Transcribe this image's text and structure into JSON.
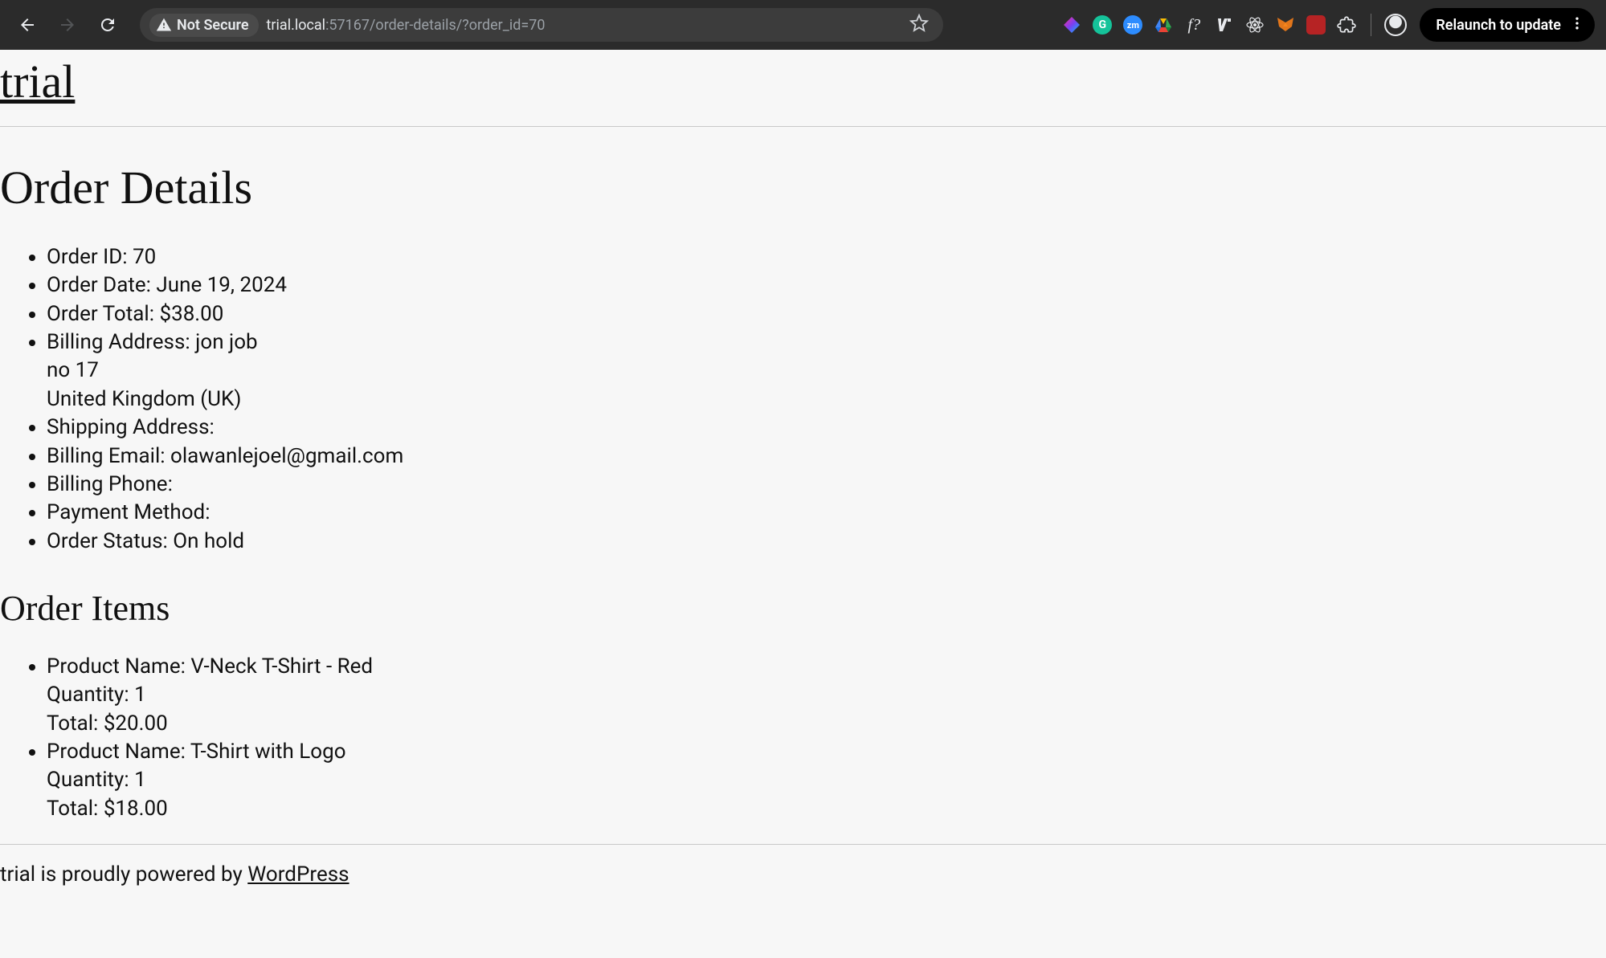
{
  "browser": {
    "not_secure_label": "Not Secure",
    "url_host": "trial.local",
    "url_rest": ":57167/order-details/?order_id=70",
    "relaunch_label": "Relaunch to update",
    "extensions": [
      {
        "name": "rainbow-diamond-icon",
        "bg": "transparent",
        "shape": "diamond"
      },
      {
        "name": "grammarly-icon",
        "bg": "#15c39a",
        "shape": "circle",
        "letter": "G"
      },
      {
        "name": "zoom-icon",
        "bg": "#2d8cff",
        "shape": "square",
        "text": "zm"
      },
      {
        "name": "drive-icon",
        "bg": "transparent",
        "shape": "triangle"
      },
      {
        "name": "fquestion-icon",
        "bg": "transparent",
        "shape": "text",
        "text": "f?"
      },
      {
        "name": "upi-icon",
        "bg": "transparent",
        "shape": "glyph"
      },
      {
        "name": "atom-icon",
        "bg": "transparent",
        "shape": "atom"
      },
      {
        "name": "metamask-icon",
        "bg": "transparent",
        "shape": "fox"
      },
      {
        "name": "red-square-icon",
        "bg": "#b62324",
        "shape": "square"
      },
      {
        "name": "extensions-puzzle-icon",
        "bg": "transparent",
        "shape": "puzzle"
      }
    ]
  },
  "site": {
    "title": "trial"
  },
  "order": {
    "heading": "Order Details",
    "labels": {
      "id": "Order ID:",
      "date": "Order Date:",
      "total": "Order Total:",
      "billing_address": "Billing Address:",
      "shipping_address": "Shipping Address:",
      "billing_email": "Billing Email:",
      "billing_phone": "Billing Phone:",
      "payment_method": "Payment Method:",
      "status": "Order Status:"
    },
    "id": "70",
    "date": "June 19, 2024",
    "total": "$38.00",
    "billing_address_line1": "jon job",
    "billing_address_line2": "no 17",
    "billing_address_line3": "United Kingdom (UK)",
    "shipping_address": "",
    "billing_email": "olawanlejoel@gmail.com",
    "billing_phone": "",
    "payment_method": "",
    "status": "On hold"
  },
  "items_heading": "Order Items",
  "item_labels": {
    "name": "Product Name:",
    "qty": "Quantity:",
    "total": "Total:"
  },
  "items": [
    {
      "name": "V-Neck T-Shirt - Red",
      "qty": "1",
      "total": "$20.00"
    },
    {
      "name": "T-Shirt with Logo",
      "qty": "1",
      "total": "$18.00"
    }
  ],
  "footer": {
    "prefix": "trial is proudly powered by ",
    "link_text": "WordPress"
  }
}
